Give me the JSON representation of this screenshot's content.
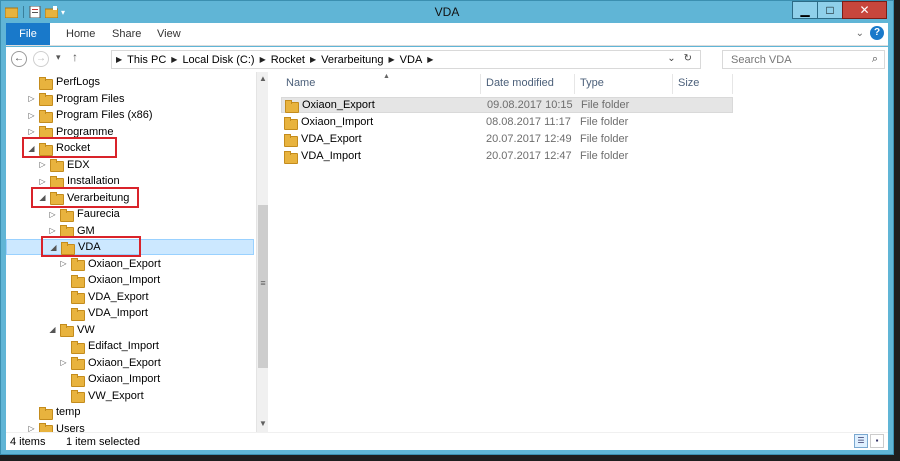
{
  "window": {
    "title": "VDA"
  },
  "ribbon": {
    "tabs": [
      "File",
      "Home",
      "Share",
      "View"
    ]
  },
  "address": {
    "crumbs": [
      "This PC",
      "Local Disk (C:)",
      "Rocket",
      "Verarbeitung",
      "VDA"
    ],
    "search_placeholder": "Search VDA"
  },
  "nav": {
    "items": [
      {
        "label": "PerfLogs",
        "indent": 0,
        "expander": ""
      },
      {
        "label": "Program Files",
        "indent": 0,
        "expander": "▷"
      },
      {
        "label": "Program Files (x86)",
        "indent": 0,
        "expander": "▷"
      },
      {
        "label": "Programme",
        "indent": 0,
        "expander": "▷"
      },
      {
        "label": "Rocket",
        "indent": 0,
        "expander": "◢"
      },
      {
        "label": "EDX",
        "indent": 1,
        "expander": "▷"
      },
      {
        "label": "Installation",
        "indent": 1,
        "expander": "▷"
      },
      {
        "label": "Verarbeitung",
        "indent": 1,
        "expander": "◢"
      },
      {
        "label": "Faurecia",
        "indent": 2,
        "expander": "▷"
      },
      {
        "label": "GM",
        "indent": 2,
        "expander": "▷"
      },
      {
        "label": "VDA",
        "indent": 2,
        "expander": "◢"
      },
      {
        "label": "Oxiaon_Export",
        "indent": 3,
        "expander": "▷"
      },
      {
        "label": "Oxiaon_Import",
        "indent": 3,
        "expander": ""
      },
      {
        "label": "VDA_Export",
        "indent": 3,
        "expander": ""
      },
      {
        "label": "VDA_Import",
        "indent": 3,
        "expander": ""
      },
      {
        "label": "VW",
        "indent": 2,
        "expander": "◢"
      },
      {
        "label": "Edifact_Import",
        "indent": 3,
        "expander": ""
      },
      {
        "label": "Oxiaon_Export",
        "indent": 3,
        "expander": "▷"
      },
      {
        "label": "Oxiaon_Import",
        "indent": 3,
        "expander": ""
      },
      {
        "label": "VW_Export",
        "indent": 3,
        "expander": ""
      },
      {
        "label": "temp",
        "indent": 0,
        "expander": ""
      },
      {
        "label": "Users",
        "indent": 0,
        "expander": "▷"
      }
    ]
  },
  "content": {
    "columns": {
      "name": "Name",
      "date": "Date modified",
      "type": "Type",
      "size": "Size"
    },
    "files": [
      {
        "name": "Oxiaon_Export",
        "date": "09.08.2017 10:15",
        "type": "File folder",
        "selected": true
      },
      {
        "name": "Oxiaon_Import",
        "date": "08.08.2017 11:17",
        "type": "File folder",
        "selected": false
      },
      {
        "name": "VDA_Export",
        "date": "20.07.2017 12:49",
        "type": "File folder",
        "selected": false
      },
      {
        "name": "VDA_Import",
        "date": "20.07.2017 12:47",
        "type": "File folder",
        "selected": false
      }
    ]
  },
  "status": {
    "items": "4 items",
    "selected": "1 item selected"
  },
  "colors": {
    "accent": "#1979ca",
    "titlebar": "#60b5d6",
    "close": "#c7463c",
    "highlight": "#d9232a"
  }
}
